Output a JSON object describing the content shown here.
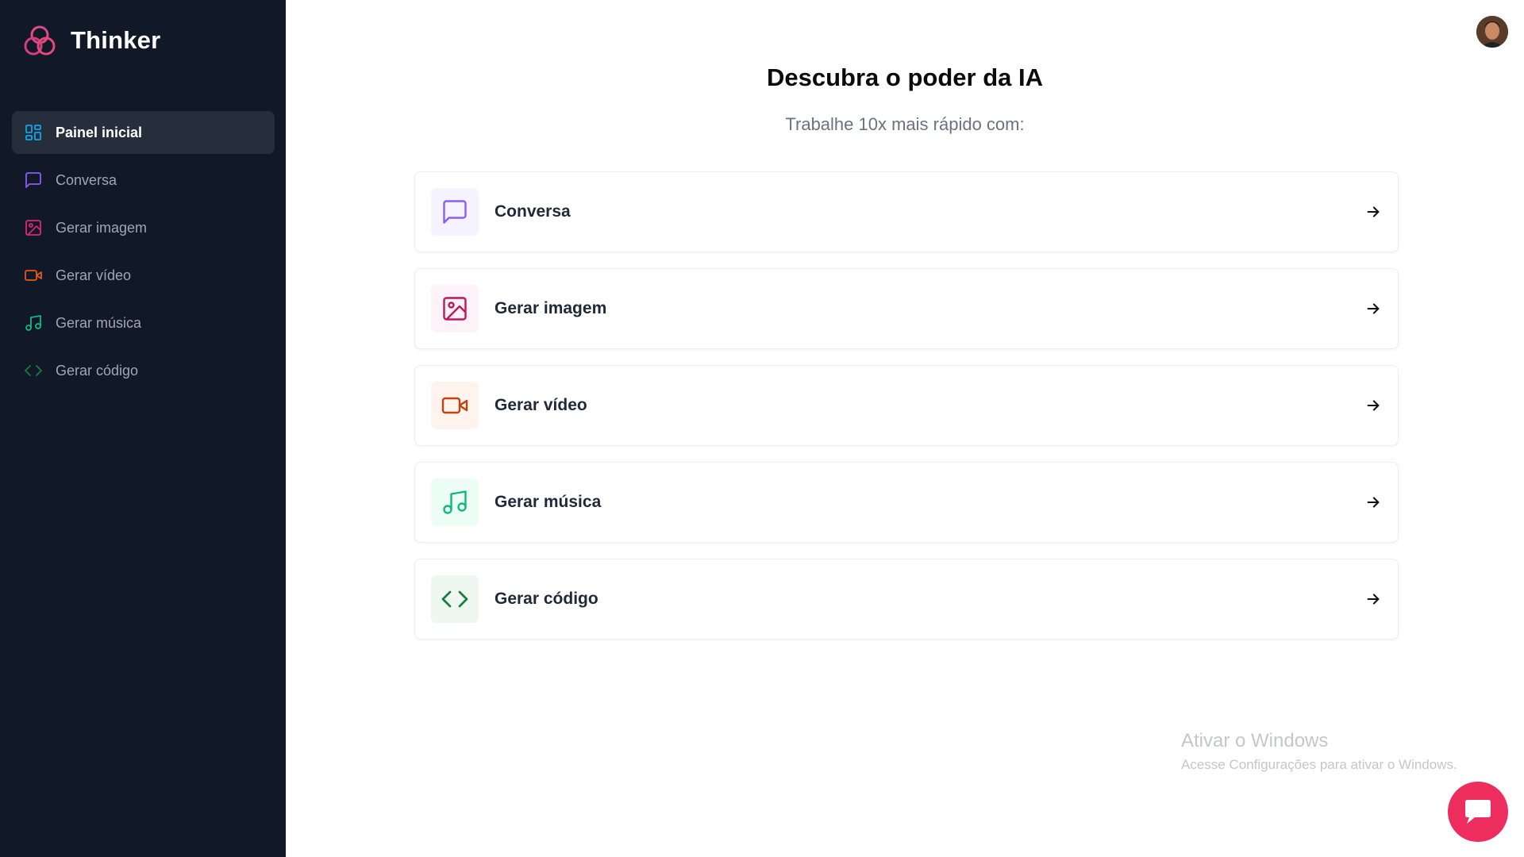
{
  "brand": {
    "name": "Thinker",
    "logo_icon": "overlapping-circles-logo"
  },
  "sidebar": {
    "items": [
      {
        "label": "Painel inicial",
        "icon": "dashboard-icon",
        "color": "#0ea5e9",
        "active": true
      },
      {
        "label": "Conversa",
        "icon": "message-square-icon",
        "color": "#8b5cf6",
        "active": false
      },
      {
        "label": "Gerar imagem",
        "icon": "image-icon",
        "color": "#db2777",
        "active": false
      },
      {
        "label": "Gerar vídeo",
        "icon": "video-icon",
        "color": "#ea580c",
        "active": false
      },
      {
        "label": "Gerar música",
        "icon": "music-icon",
        "color": "#10b981",
        "active": false
      },
      {
        "label": "Gerar código",
        "icon": "code-icon",
        "color": "#15803d",
        "active": false
      }
    ]
  },
  "main": {
    "title": "Descubra o poder da IA",
    "subtitle": "Trabalhe 10x mais rápido com:",
    "tools": [
      {
        "label": "Conversa",
        "icon": "message-square-icon",
        "color": "#8b5cf6",
        "bg": "#f5f3ff"
      },
      {
        "label": "Gerar imagem",
        "icon": "image-icon",
        "color": "#be185d",
        "bg": "#fdf2f8"
      },
      {
        "label": "Gerar vídeo",
        "icon": "video-icon",
        "color": "#c2410c",
        "bg": "#fff4ed"
      },
      {
        "label": "Gerar música",
        "icon": "music-icon",
        "color": "#10b981",
        "bg": "#ecfdf5"
      },
      {
        "label": "Gerar código",
        "icon": "code-icon",
        "color": "#15803d",
        "bg": "#eef7f0"
      }
    ]
  },
  "windows_watermark": {
    "title": "Ativar o Windows",
    "subtitle": "Acesse Configurações para ativar o Windows."
  },
  "colors": {
    "sidebar_bg": "#111827",
    "active_item_bg": "#262d3b",
    "chat_button": "#ee2d5f"
  }
}
